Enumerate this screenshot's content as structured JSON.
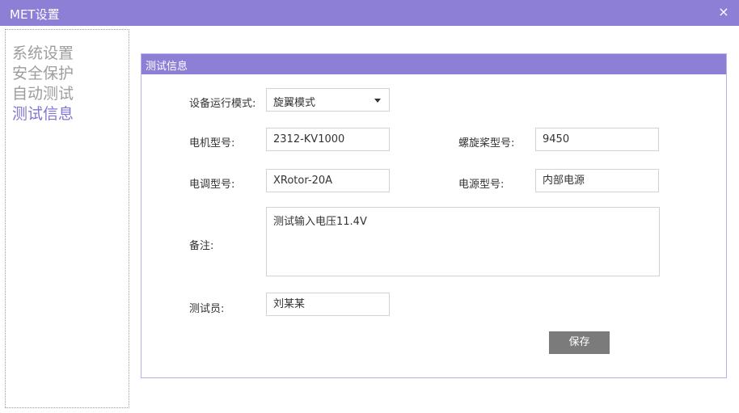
{
  "window": {
    "title": "MET设置",
    "close_glyph": "×"
  },
  "sidebar": {
    "items": [
      {
        "label": "系统设置"
      },
      {
        "label": "安全保护"
      },
      {
        "label": "自动测试"
      },
      {
        "label": "测试信息",
        "active": true
      }
    ]
  },
  "panel": {
    "title": "测试信息",
    "run_mode": {
      "label": "设备运行模式:",
      "value": "旋翼模式"
    },
    "motor_model": {
      "label": "电机型号:",
      "value": "2312-KV1000"
    },
    "propeller_model": {
      "label": "螺旋桨型号:",
      "value": "9450"
    },
    "esc_model": {
      "label": "电调型号:",
      "value": "XRotor-20A"
    },
    "power_model": {
      "label": "电源型号:",
      "value": "内部电源"
    },
    "remarks": {
      "label": "备注:",
      "value": "测试输入电压11.4V"
    },
    "tester": {
      "label": "测试员:",
      "value": "刘某某"
    },
    "save_label": "保存"
  },
  "colors": {
    "accent": "#8d7fd6",
    "active_nav": "#7f76d4",
    "inactive_nav": "#9d9d9d",
    "save_button": "#7b7b7b"
  }
}
